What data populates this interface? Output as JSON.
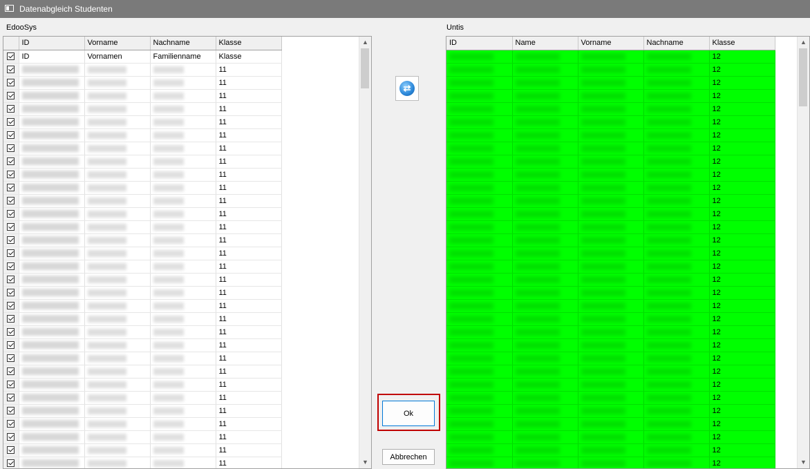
{
  "window": {
    "title": "Datenabgleich Studenten"
  },
  "left_group": {
    "label": "EdooSys",
    "columns": [
      "",
      "ID",
      "Vorname",
      "Nachname",
      "Klasse"
    ],
    "header_row": {
      "checked": true,
      "id": "ID",
      "vorname": "Vornamen",
      "nachname": "Familienname",
      "klasse": "Klasse"
    },
    "rows": [
      {
        "checked": true,
        "klasse": "11"
      },
      {
        "checked": true,
        "klasse": "11"
      },
      {
        "checked": true,
        "klasse": "11"
      },
      {
        "checked": true,
        "klasse": "11"
      },
      {
        "checked": true,
        "klasse": "11"
      },
      {
        "checked": true,
        "klasse": "11"
      },
      {
        "checked": true,
        "klasse": "11"
      },
      {
        "checked": true,
        "klasse": "11"
      },
      {
        "checked": true,
        "klasse": "11"
      },
      {
        "checked": true,
        "klasse": "11"
      },
      {
        "checked": true,
        "klasse": "11"
      },
      {
        "checked": true,
        "klasse": "11"
      },
      {
        "checked": true,
        "klasse": "11"
      },
      {
        "checked": true,
        "klasse": "11"
      },
      {
        "checked": true,
        "klasse": "11"
      },
      {
        "checked": true,
        "klasse": "11"
      },
      {
        "checked": true,
        "klasse": "11"
      },
      {
        "checked": true,
        "klasse": "11"
      },
      {
        "checked": true,
        "klasse": "11"
      },
      {
        "checked": true,
        "klasse": "11"
      },
      {
        "checked": true,
        "klasse": "11"
      },
      {
        "checked": true,
        "klasse": "11"
      },
      {
        "checked": true,
        "klasse": "11"
      },
      {
        "checked": true,
        "klasse": "11"
      },
      {
        "checked": true,
        "klasse": "11"
      },
      {
        "checked": true,
        "klasse": "11"
      },
      {
        "checked": true,
        "klasse": "11"
      },
      {
        "checked": true,
        "klasse": "11"
      },
      {
        "checked": true,
        "klasse": "11"
      },
      {
        "checked": true,
        "klasse": "11"
      },
      {
        "checked": true,
        "klasse": "11"
      }
    ]
  },
  "right_group": {
    "label": "Untis",
    "columns": [
      "ID",
      "Name",
      "Vorname",
      "Nachname",
      "Klasse"
    ],
    "rows": [
      {
        "klasse": "12"
      },
      {
        "klasse": "12"
      },
      {
        "klasse": "12"
      },
      {
        "klasse": "12"
      },
      {
        "klasse": "12"
      },
      {
        "klasse": "12"
      },
      {
        "klasse": "12"
      },
      {
        "klasse": "12"
      },
      {
        "klasse": "12"
      },
      {
        "klasse": "12"
      },
      {
        "klasse": "12"
      },
      {
        "klasse": "12"
      },
      {
        "klasse": "12"
      },
      {
        "klasse": "12"
      },
      {
        "klasse": "12"
      },
      {
        "klasse": "12"
      },
      {
        "klasse": "12"
      },
      {
        "klasse": "12"
      },
      {
        "klasse": "12"
      },
      {
        "klasse": "12"
      },
      {
        "klasse": "12"
      },
      {
        "klasse": "12"
      },
      {
        "klasse": "12"
      },
      {
        "klasse": "12"
      },
      {
        "klasse": "12"
      },
      {
        "klasse": "12"
      },
      {
        "klasse": "12"
      },
      {
        "klasse": "12"
      },
      {
        "klasse": "12"
      },
      {
        "klasse": "12"
      },
      {
        "klasse": "12"
      },
      {
        "klasse": "12"
      }
    ]
  },
  "buttons": {
    "ok": "Ok",
    "cancel": "Abbrechen"
  },
  "icons": {
    "swap": "swap-arrows-icon",
    "window": "window-icon"
  },
  "colors": {
    "match_row": "#00ff00",
    "highlight_border": "#c00000",
    "title_bar": "#7a7a7a"
  }
}
